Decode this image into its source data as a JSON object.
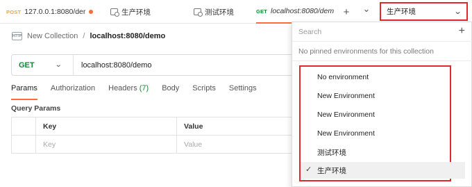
{
  "tabs": [
    {
      "method": "POST",
      "label": "127.0.0.1:8080/der",
      "unsaved": true
    },
    {
      "label": "生产环境"
    },
    {
      "label": "测试环境"
    },
    {
      "method": "GET",
      "label": "localhost:8080/dem"
    }
  ],
  "tab_controls": {
    "add": "+",
    "more": "⌄"
  },
  "env_selector": {
    "value": "生产环境"
  },
  "breadcrumb": {
    "badge": "HTTP",
    "collection": "New Collection",
    "separator": "/",
    "request": "localhost:8080/demo"
  },
  "request": {
    "method": "GET",
    "url": "localhost:8080/demo"
  },
  "request_tabs": [
    {
      "label": "Params"
    },
    {
      "label": "Authorization"
    },
    {
      "label": "Headers",
      "count": "(7)"
    },
    {
      "label": "Body"
    },
    {
      "label": "Scripts"
    },
    {
      "label": "Settings"
    }
  ],
  "params": {
    "title": "Query Params",
    "headers": {
      "key": "Key",
      "value": "Value"
    },
    "placeholder": {
      "key": "Key",
      "value": "Value"
    }
  },
  "env_dropdown": {
    "search_placeholder": "Search",
    "message": "No pinned environments for this collection",
    "items": [
      "No environment",
      "New Environment",
      "New Environment",
      "New Environment",
      "测试环境",
      "生产环境"
    ],
    "selected": "生产环境"
  },
  "colors": {
    "accent": "#ff6c37",
    "get": "#0f8a2f",
    "post": "#f5a623",
    "highlight": "#e0282e"
  }
}
